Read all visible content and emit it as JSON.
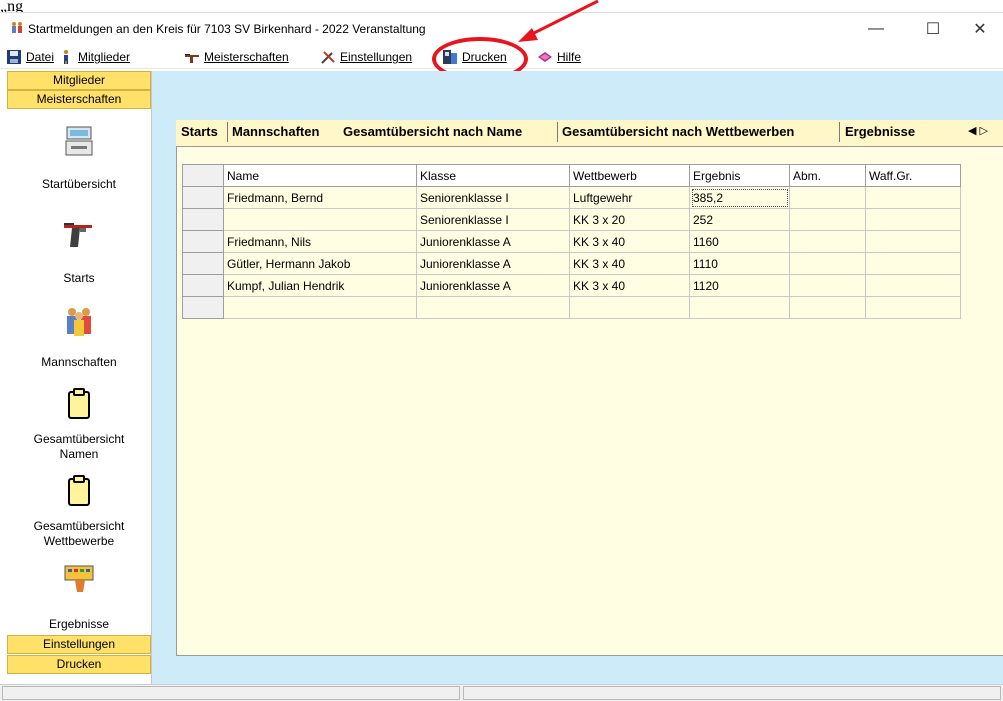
{
  "document": {
    "fragment": "„ng"
  },
  "window": {
    "title": "Startmeldungen an den Kreis für 7103 SV Birkenhard - 2022   Veranstaltung",
    "minimize": "—",
    "maximize": "☐",
    "close": "✕"
  },
  "menu": {
    "datei": "Datei",
    "mitglieder": "Mitglieder",
    "meisterschaften": "Meisterschaften",
    "einstellungen": "Einstellungen",
    "drucken": "Drucken",
    "hilfe": "Hilfe"
  },
  "nav": {
    "headers": {
      "mitglieder": "Mitglieder",
      "meisterschaften": "Meisterschaften",
      "einstellungen": "Einstellungen",
      "drucken": "Drucken"
    },
    "items": {
      "startuebersicht": "Startübersicht",
      "starts": "Starts",
      "mannschaften": "Mannschaften",
      "gesamt_namen_1": "Gesamtübersicht",
      "gesamt_namen_2": "Namen",
      "gesamt_wettb_1": "Gesamtübersicht",
      "gesamt_wettb_2": "Wettbewerbe",
      "ergebnisse": "Ergebnisse"
    }
  },
  "tabs": {
    "starts": "Starts",
    "mannschaften": "Mannschaften",
    "name": "Gesamtübersicht nach Name",
    "wettbewerben": "Gesamtübersicht nach Wettbewerben",
    "ergebnisse": "Ergebnisse",
    "scroll": "◀ ▷"
  },
  "grid": {
    "columns": {
      "name": "Name",
      "klasse": "Klasse",
      "wettbewerb": "Wettbewerb",
      "ergebnis": "Ergebnis",
      "abm": "Abm.",
      "waff": "Waff.Gr."
    },
    "rows": [
      {
        "name": "Friedmann, Bernd",
        "klasse": "Seniorenklasse I",
        "wettbewerb": "Luftgewehr",
        "ergebnis": "385,2"
      },
      {
        "name": "",
        "klasse": "Seniorenklasse I",
        "wettbewerb": "KK 3 x 20",
        "ergebnis": "252"
      },
      {
        "name": "Friedmann, Nils",
        "klasse": "Juniorenklasse A",
        "wettbewerb": "KK 3 x 40",
        "ergebnis": "1160"
      },
      {
        "name": "Gütler, Hermann Jakob",
        "klasse": "Juniorenklasse A",
        "wettbewerb": "KK 3 x 40",
        "ergebnis": "1110"
      },
      {
        "name": "Kumpf, Julian Hendrik",
        "klasse": "Juniorenklasse A",
        "wettbewerb": "KK 3 x 40",
        "ergebnis": "1120"
      }
    ]
  },
  "colors": {
    "nav_header": "#ffe16a",
    "right_bg": "#cdebf8",
    "grid_bg": "#fffde2",
    "annotation": "#e8141e"
  }
}
